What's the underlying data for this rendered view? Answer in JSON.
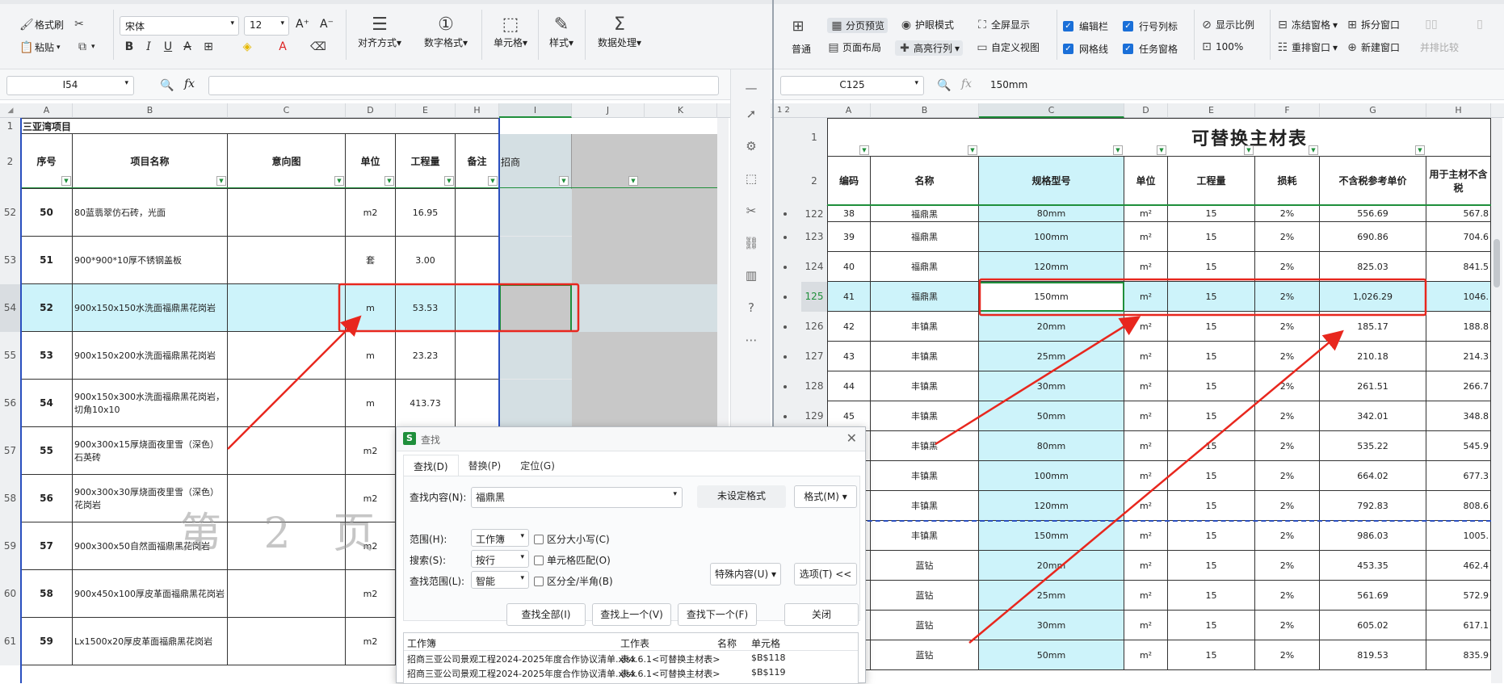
{
  "left": {
    "ribbon": {
      "format_painter": "格式刷",
      "paste": "粘贴",
      "font_name": "宋体",
      "font_size": "12",
      "align": "对齐方式",
      "number_format": "数字格式",
      "cell": "单元格",
      "style": "样式",
      "data_processing": "数据处理"
    },
    "name_box": "I54",
    "formula": "",
    "col_headers": [
      "A",
      "B",
      "C",
      "D",
      "E",
      "H",
      "I",
      "J",
      "K"
    ],
    "title": "三亚湾项目",
    "headers": {
      "seq": "序号",
      "name": "项目名称",
      "image": "意向图",
      "unit": "单位",
      "qty": "工程量",
      "note": "备注",
      "bid": "招商"
    },
    "row_numbers": [
      "1",
      "2",
      "52",
      "53",
      "54",
      "55",
      "56",
      "57",
      "58",
      "59",
      "60",
      "61"
    ],
    "rows": [
      {
        "seq": "50",
        "name": "80蓝翡翠仿石砖，光面",
        "unit": "m2",
        "qty": "16.95"
      },
      {
        "seq": "51",
        "name": "900*900*10厚不锈钢盖板",
        "unit": "套",
        "qty": "3.00"
      },
      {
        "seq": "52",
        "name": "900x150x150水洗面福鼎黑花岗岩",
        "unit": "m",
        "qty": "53.53"
      },
      {
        "seq": "53",
        "name": "900x150x200水洗面福鼎黑花岗岩",
        "unit": "m",
        "qty": "23.23"
      },
      {
        "seq": "54",
        "name": "900x150x300水洗面福鼎黑花岗岩，切角10x10",
        "unit": "m",
        "qty": "413.73"
      },
      {
        "seq": "55",
        "name": "900x300x15厚烧面夜里雪（深色）石英砖",
        "unit": "m2",
        "qty": ""
      },
      {
        "seq": "56",
        "name": "900x300x30厚烧面夜里雪（深色）花岗岩",
        "unit": "m2",
        "qty": ""
      },
      {
        "seq": "57",
        "name": "900x300x50自然面福鼎黑花岗岩",
        "unit": "m2",
        "qty": ""
      },
      {
        "seq": "58",
        "name": "900x450x100厚皮革面福鼎黑花岗岩",
        "unit": "m2",
        "qty": ""
      },
      {
        "seq": "59",
        "name": "Lx1500x20厚皮革面福鼎黑花岗岩",
        "unit": "m2",
        "qty": ""
      }
    ],
    "watermark": "第 2 页"
  },
  "right": {
    "ribbon": {
      "normal": "普通",
      "page_break": "分页预览",
      "eye_mode": "护眼模式",
      "fullscreen": "全屏显示",
      "edit_bar": "编辑栏",
      "row_col_labels": "行号列标",
      "show_ratio": "显示比例",
      "freeze": "冻结窗格",
      "split": "拆分窗口",
      "page_layout": "页面布局",
      "highlight_rows": "高亮行列",
      "custom_view": "自定义视图",
      "gridlines": "网格线",
      "task_pane": "任务窗格",
      "zoom": "100%",
      "rearrange": "重排窗口",
      "new_window": "新建窗口",
      "compare": "并排比较"
    },
    "name_box": "C125",
    "formula": "150mm",
    "col_headers": [
      "A",
      "B",
      "C",
      "D",
      "E",
      "F",
      "G",
      "H"
    ],
    "title": "可替换主材表",
    "headers": {
      "code": "编码",
      "name": "名称",
      "spec": "规格型号",
      "unit": "单位",
      "qty": "工程量",
      "loss": "损耗",
      "price": "不含税参考单价",
      "main": "用于主材不含税"
    },
    "rows": [
      {
        "rn": "122",
        "code": "38",
        "name": "福鼎黑",
        "spec": "80mm",
        "unit": "m²",
        "qty": "15",
        "loss": "2%",
        "price": "556.69",
        "main": "567.8"
      },
      {
        "rn": "123",
        "code": "39",
        "name": "福鼎黑",
        "spec": "100mm",
        "unit": "m²",
        "qty": "15",
        "loss": "2%",
        "price": "690.86",
        "main": "704.6"
      },
      {
        "rn": "124",
        "code": "40",
        "name": "福鼎黑",
        "spec": "120mm",
        "unit": "m²",
        "qty": "15",
        "loss": "2%",
        "price": "825.03",
        "main": "841.5"
      },
      {
        "rn": "125",
        "code": "41",
        "name": "福鼎黑",
        "spec": "150mm",
        "unit": "m²",
        "qty": "15",
        "loss": "2%",
        "price": "1,026.29",
        "main": "1046."
      },
      {
        "rn": "126",
        "code": "42",
        "name": "丰镇黑",
        "spec": "20mm",
        "unit": "m²",
        "qty": "15",
        "loss": "2%",
        "price": "185.17",
        "main": "188.8"
      },
      {
        "rn": "127",
        "code": "43",
        "name": "丰镇黑",
        "spec": "25mm",
        "unit": "m²",
        "qty": "15",
        "loss": "2%",
        "price": "210.18",
        "main": "214.3"
      },
      {
        "rn": "128",
        "code": "44",
        "name": "丰镇黑",
        "spec": "30mm",
        "unit": "m²",
        "qty": "15",
        "loss": "2%",
        "price": "261.51",
        "main": "266.7"
      },
      {
        "rn": "129",
        "code": "45",
        "name": "丰镇黑",
        "spec": "50mm",
        "unit": "m²",
        "qty": "15",
        "loss": "2%",
        "price": "342.01",
        "main": "348.8"
      },
      {
        "rn": "",
        "code": "",
        "name": "丰镇黑",
        "spec": "80mm",
        "unit": "m²",
        "qty": "15",
        "loss": "2%",
        "price": "535.22",
        "main": "545.9"
      },
      {
        "rn": "",
        "code": "",
        "name": "丰镇黑",
        "spec": "100mm",
        "unit": "m²",
        "qty": "15",
        "loss": "2%",
        "price": "664.02",
        "main": "677.3"
      },
      {
        "rn": "",
        "code": "",
        "name": "丰镇黑",
        "spec": "120mm",
        "unit": "m²",
        "qty": "15",
        "loss": "2%",
        "price": "792.83",
        "main": "808.6"
      },
      {
        "rn": "",
        "code": "",
        "name": "丰镇黑",
        "spec": "150mm",
        "unit": "m²",
        "qty": "15",
        "loss": "2%",
        "price": "986.03",
        "main": "1005."
      },
      {
        "rn": "",
        "code": "",
        "name": "蓝钻",
        "spec": "20mm",
        "unit": "m²",
        "qty": "15",
        "loss": "2%",
        "price": "453.35",
        "main": "462.4"
      },
      {
        "rn": "",
        "code": "",
        "name": "蓝钻",
        "spec": "25mm",
        "unit": "m²",
        "qty": "15",
        "loss": "2%",
        "price": "561.69",
        "main": "572.9"
      },
      {
        "rn": "",
        "code": "",
        "name": "蓝钻",
        "spec": "30mm",
        "unit": "m²",
        "qty": "15",
        "loss": "2%",
        "price": "605.02",
        "main": "617.1"
      },
      {
        "rn": "",
        "code": "",
        "name": "蓝钻",
        "spec": "50mm",
        "unit": "m²",
        "qty": "15",
        "loss": "2%",
        "price": "819.53",
        "main": "835.9"
      }
    ]
  },
  "dialog": {
    "title": "查找",
    "tabs": [
      "查找(D)",
      "替换(P)",
      "定位(G)"
    ],
    "find_label": "查找内容(N):",
    "find_value": "福鼎黑",
    "no_format": "未设定格式",
    "format_btn": "格式(M)",
    "scope_label": "范围(H):",
    "scope_value": "工作簿",
    "search_label": "搜索(S):",
    "search_value": "按行",
    "lookin_label": "查找范围(L):",
    "lookin_value": "智能",
    "match_case": "区分大小写(C)",
    "match_cell": "单元格匹配(O)",
    "match_width": "区分全/半角(B)",
    "special": "特殊内容(U)",
    "options": "选项(T) <<",
    "find_all": "查找全部(I)",
    "find_prev": "查找上一个(V)",
    "find_next": "查找下一个(F)",
    "close": "关闭",
    "result_headers": [
      "工作簿",
      "工作表",
      "名称",
      "单元格"
    ],
    "results": [
      {
        "book": "招商三亚公司景观工程2024-2025年度合作协议清单.xlsx",
        "sheet": "表4.6.1<可替换主材表>",
        "name": "",
        "cell": "$B$118"
      },
      {
        "book": "招商三亚公司景观工程2024-2025年度合作协议清单.xlsx",
        "sheet": "表4.6.1<可替换主材表>",
        "name": "",
        "cell": "$B$119"
      }
    ]
  }
}
